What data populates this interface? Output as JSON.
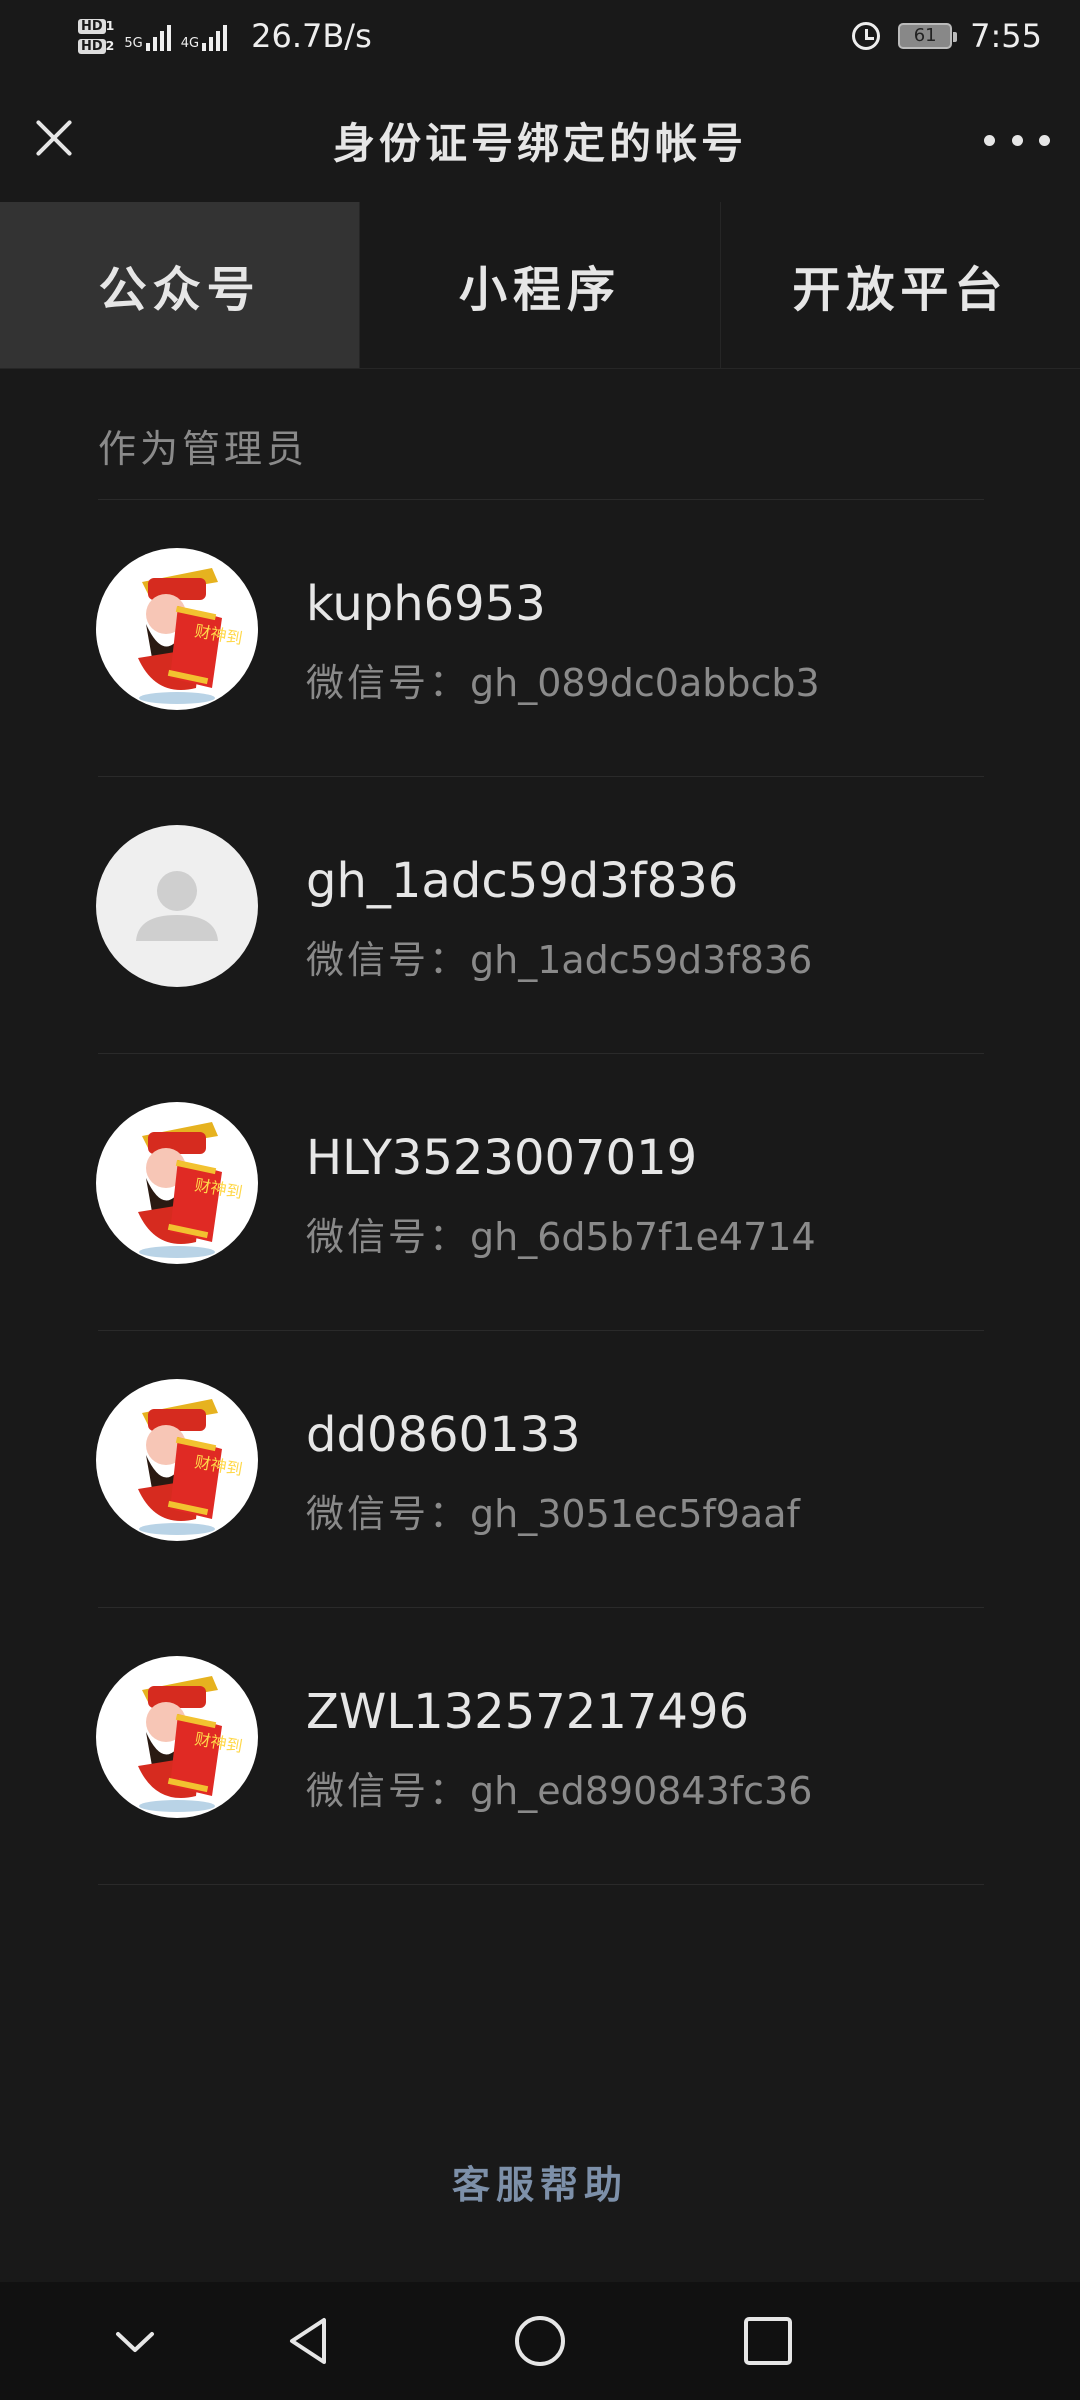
{
  "status_bar": {
    "hd1": "HD",
    "hd1_sub": "1",
    "hd2": "HD",
    "hd2_sub": "2",
    "net1": "5G",
    "net2": "4G",
    "speed": "26.7B/s",
    "battery": "61",
    "time": "7:55"
  },
  "header": {
    "title": "身份证号绑定的帐号"
  },
  "tabs": [
    {
      "label": "公众号",
      "active": true
    },
    {
      "label": "小程序",
      "active": false
    },
    {
      "label": "开放平台",
      "active": false
    }
  ],
  "section": {
    "label": "作为管理员"
  },
  "accounts": [
    {
      "name": "kuph6953",
      "id_label": "微信号：",
      "id": "gh_089dc0abbcb3",
      "avatar": "caishen"
    },
    {
      "name": "gh_1adc59d3f836",
      "id_label": "微信号：",
      "id": "gh_1adc59d3f836",
      "avatar": "default-user"
    },
    {
      "name": "HLY3523007019",
      "id_label": "微信号：",
      "id": "gh_6d5b7f1e4714",
      "avatar": "caishen"
    },
    {
      "name": "dd0860133",
      "id_label": "微信号：",
      "id": "gh_3051ec5f9aaf",
      "avatar": "caishen"
    },
    {
      "name": "ZWL13257217496",
      "id_label": "微信号：",
      "id": "gh_ed890843fc36",
      "avatar": "caishen"
    }
  ],
  "avatar_scroll_text": "财神到",
  "footer": {
    "help_label": "客服帮助"
  },
  "colors": {
    "background": "#191919",
    "active_tab": "#333333",
    "link": "#7d90a9",
    "secondary_text": "#8a8a8a"
  }
}
